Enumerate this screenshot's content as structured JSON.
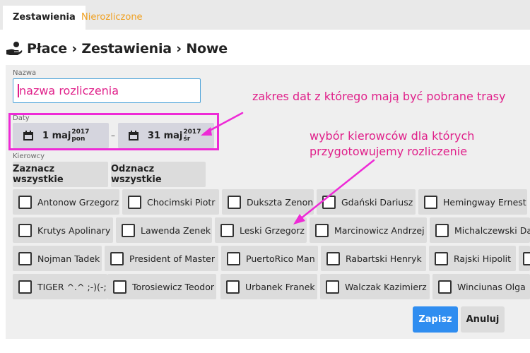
{
  "tabs": [
    {
      "label": "Zestawienia",
      "active": true
    },
    {
      "label": "Nierozliczone",
      "active": false
    }
  ],
  "header": {
    "title": "Płace › Zestawienia › Nowe",
    "icon": "hand-coin-icon"
  },
  "form": {
    "name_label": "Nazwa",
    "name_placeholder": "nazwa rozliczenia",
    "dates_label": "Daty",
    "date_from": {
      "day_month": "1 maj",
      "year": "2017",
      "weekday": "pon"
    },
    "date_separator": "–",
    "date_to": {
      "day_month": "31 maj",
      "year": "2017",
      "weekday": "śr"
    },
    "drivers_label": "Kierowcy",
    "select_all": "Zaznacz wszystkie",
    "deselect_all": "Odznacz wszystkie",
    "drivers": [
      "Antonow Grzegorz",
      "Chocimski Piotr",
      "Duksztа Zenon",
      "Gdański Dariusz",
      "Hemingway Ernest",
      "Krutys Apolinary",
      "Lawenda Zenek",
      "Leski Grzegorz",
      "Marcinowicz Andrzej",
      "Michalczewski Dariusz",
      "Nojman Tadek",
      "President of Master",
      "PuertoRico Man",
      "Rabartski Henryk",
      "Rajski Hipolit",
      "TIGER ^.^ ;-)(-;",
      "Torosiewicz Teodor",
      "Urbanek Franek",
      "Walczak Kazimierz",
      "Winciunas Olga"
    ],
    "save": "Zapisz",
    "cancel": "Anuluj"
  },
  "annotations": {
    "dates_note": "zakres dat z którego mają być pobrane trasy",
    "drivers_note_line1": "wybór kierowców dla których",
    "drivers_note_line2": "przygotowujemy rozliczenie"
  },
  "colors": {
    "accent": "#2f8df0",
    "annotation": "#e0208a",
    "tab_inactive": "#f0a020",
    "highlight_box": "#ee2ad6"
  }
}
